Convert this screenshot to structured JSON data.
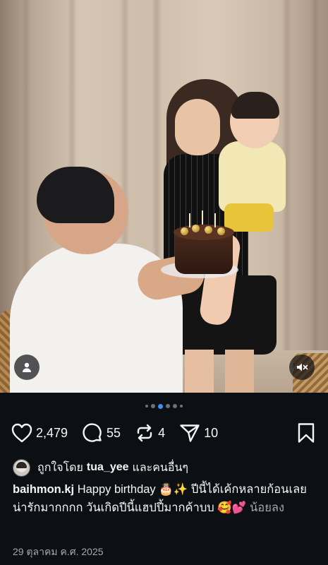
{
  "post": {
    "likes": "2,479",
    "comments": "55",
    "reposts": "4",
    "shares": "10"
  },
  "carousel": {
    "dot_count": 6,
    "active_index": 2
  },
  "liked_by": {
    "prefix": "ถูกใจโดย",
    "user": "tua_yee",
    "suffix": "และคนอื่นๆ"
  },
  "caption": {
    "username": "baihmon.kj",
    "text": "Happy birthday 🎂✨ ปีนี้ได้เค้กหลายก้อนเลย น่ารักมากกกก วันเกิดปีนี้แฮปปี้มากค้าบบ 🥰💕",
    "more_label": "น้อยลง"
  },
  "date": "29 ตุลาคม ค.ศ. 2025",
  "colors": {
    "background": "#0c1014",
    "accent_dot": "#3d8ef7",
    "muted_text": "#a8a8a8"
  },
  "icons": {
    "like": "heart-icon",
    "comment": "comment-icon",
    "repost": "repost-icon",
    "share": "share-icon",
    "save": "bookmark-icon",
    "tag": "user-tag-icon",
    "mute": "speaker-muted-icon"
  }
}
